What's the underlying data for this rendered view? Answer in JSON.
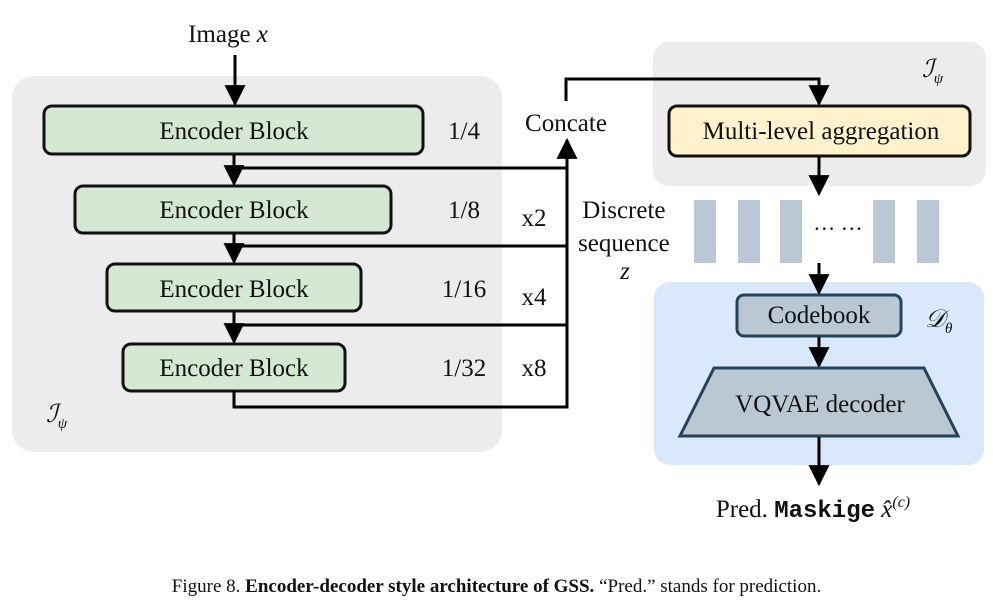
{
  "input_label": {
    "text": "Image ",
    "var": "x"
  },
  "encoder_region": {
    "label": "ℐ",
    "sub": "ψ"
  },
  "encoder_blocks": [
    {
      "label": "Encoder Block",
      "scale": "1/4",
      "mult": ""
    },
    {
      "label": "Encoder Block",
      "scale": "1/8",
      "mult": "x2"
    },
    {
      "label": "Encoder Block",
      "scale": "1/16",
      "mult": "x4"
    },
    {
      "label": "Encoder Block",
      "scale": "1/32",
      "mult": "x8"
    }
  ],
  "concat_label": "Concate",
  "aggregation_region": {
    "label": "ℐ",
    "sub": "ψ"
  },
  "aggregation_block": "Multi-level aggregation",
  "sequence_label": {
    "line1": "Discrete",
    "line2": "sequence",
    "var": "z"
  },
  "sequence_ellipsis": "··· ···",
  "decoder_region": {
    "label": "𝒟",
    "sub": "θ"
  },
  "codebook_block": "Codebook",
  "vqvae_block": "VQVAE decoder",
  "output_label": {
    "prefix": "Pred. ",
    "mono": "Maskige",
    "var": "x̂",
    "sup": "(c)"
  },
  "caption": {
    "prefix": "Figure 8. ",
    "bold": "Encoder-decoder style architecture of GSS.",
    "rest": " “Pred.” stands for prediction."
  },
  "colors": {
    "encoder_fill": "#d5e8d4",
    "aggregation_fill": "#fff2cc",
    "decoder_region_fill": "#dae8fc",
    "gray_region_fill": "#ececec",
    "token_fill": "#b9c8d4",
    "codebook_fill": "#bac8d3",
    "codebook_stroke": "#23445d"
  }
}
